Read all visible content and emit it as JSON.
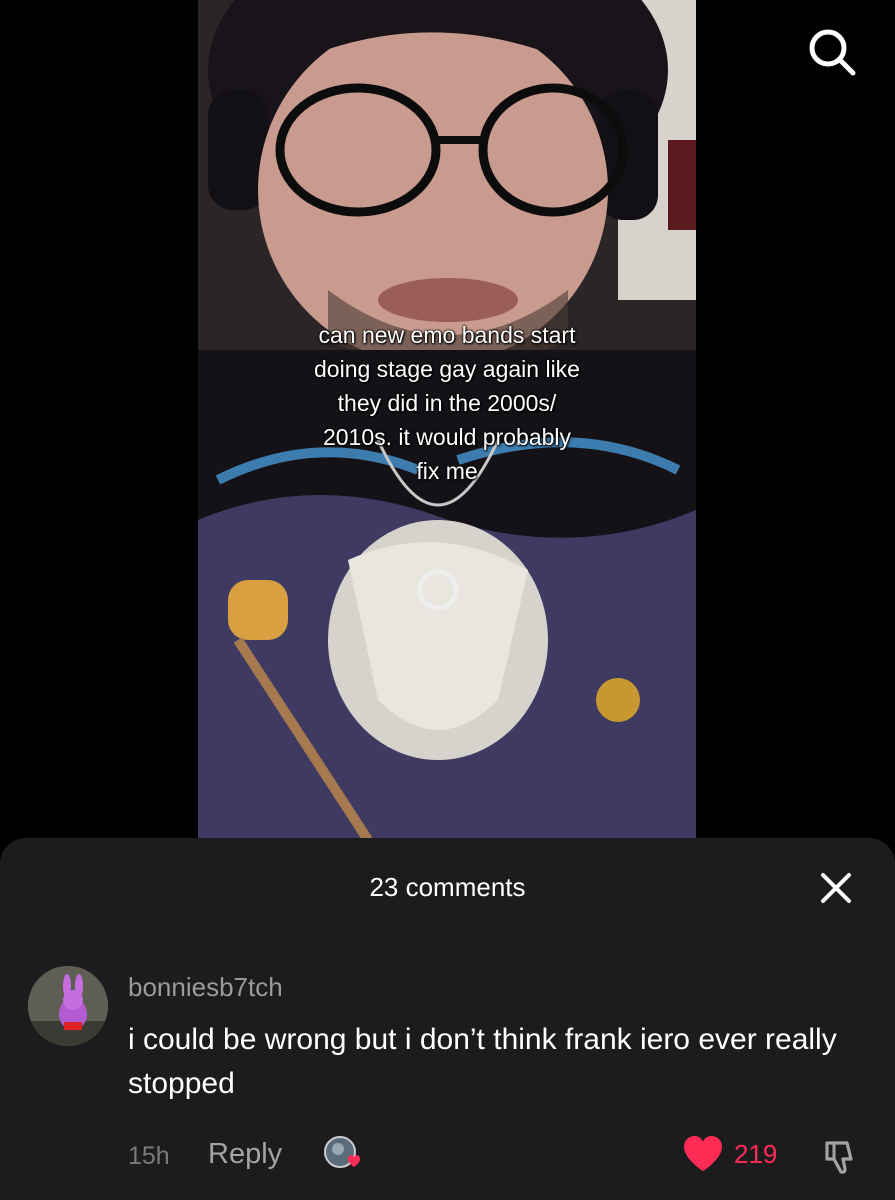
{
  "video": {
    "caption_lines": [
      "can new emo bands start",
      "doing stage gay again like",
      "they did in the 2000s/",
      "2010s. it would probably",
      "fix me"
    ]
  },
  "icons": {
    "search": "search-icon",
    "close": "close-icon",
    "heart": "heart-icon",
    "dislike": "thumbs-down-icon"
  },
  "comments_sheet": {
    "title": "23 comments",
    "comment": {
      "username": "bonniesb7tch",
      "text": "i could be wrong but i don’t think frank iero ever really stopped",
      "timestamp": "15h",
      "reply_label": "Reply",
      "like_count": "219"
    }
  },
  "colors": {
    "like_red": "#fe2c55",
    "sheet_bg": "#1c1c1e"
  }
}
